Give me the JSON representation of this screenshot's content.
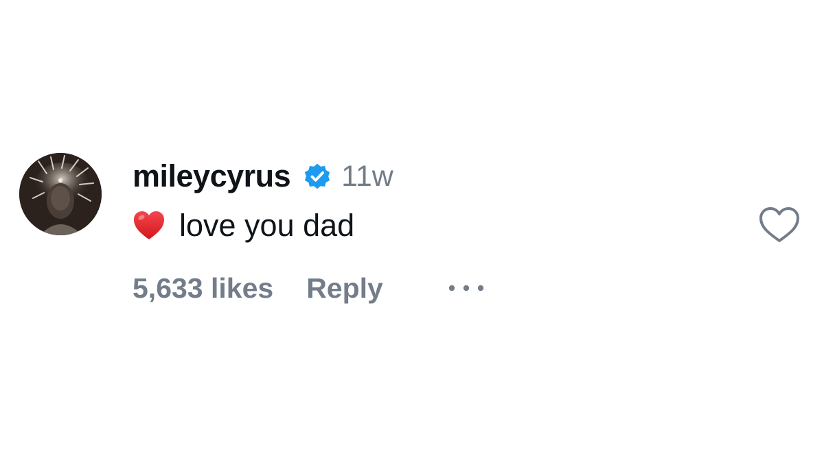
{
  "comment": {
    "username": "mileycyrus",
    "verified": true,
    "timestamp": "11w",
    "text": "love you dad",
    "emoji": "heart",
    "likes": "5,633 likes",
    "reply_label": "Reply",
    "liked": false
  },
  "icons": {
    "avatar": "avatar-photo",
    "verified": "verified-badge-icon",
    "emoji": "red-heart-emoji",
    "more": "more-options-icon",
    "like": "heart-outline-icon"
  },
  "colors": {
    "text_primary": "#0f1419",
    "text_secondary": "#737d8a",
    "verified_blue": "#1d9bf0",
    "heart_red": "#e0242a",
    "icon_outline": "#737d8a"
  }
}
